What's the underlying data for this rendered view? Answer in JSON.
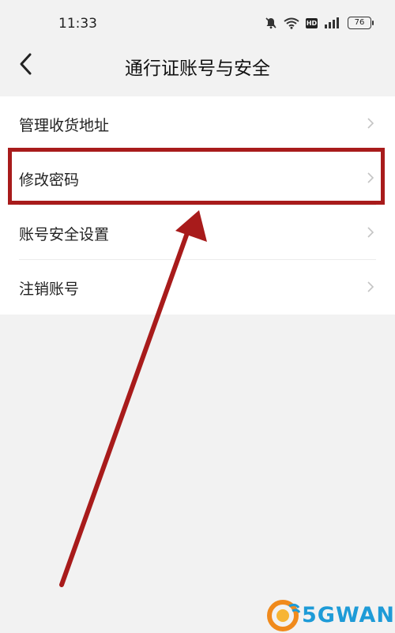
{
  "status_bar": {
    "time": "11:33",
    "battery": "76",
    "icons": [
      "mute-icon",
      "wifi-icon",
      "hd-icon",
      "signal-icon",
      "battery-icon"
    ]
  },
  "nav": {
    "title": "通行证账号与安全",
    "back_icon": "chevron-left-icon"
  },
  "menu": {
    "items": [
      {
        "label": "管理收货地址"
      },
      {
        "label": "修改密码"
      },
      {
        "label": "账号安全设置"
      },
      {
        "label": "注销账号"
      }
    ]
  },
  "annotation": {
    "color": "#a81b1b",
    "highlighted_item": "修改密码"
  },
  "watermark": {
    "text": "5GWAN",
    "color": "#1e9bd7"
  },
  "colors": {
    "background": "#f2f2f2",
    "card": "#ffffff",
    "text": "#222222"
  }
}
